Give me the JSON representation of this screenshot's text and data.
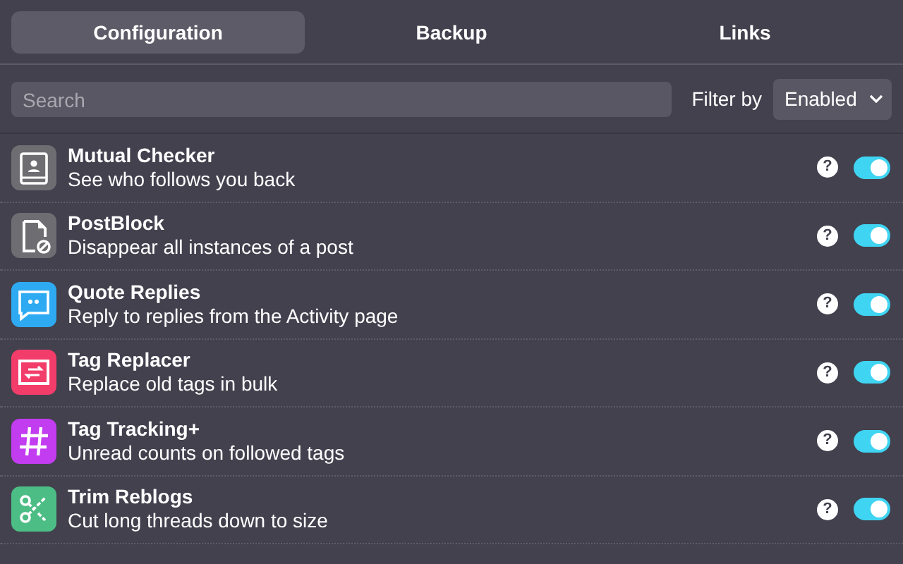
{
  "tabs": [
    {
      "label": "Configuration",
      "selected": true
    },
    {
      "label": "Backup",
      "selected": false
    },
    {
      "label": "Links",
      "selected": false
    }
  ],
  "search": {
    "placeholder": "Search"
  },
  "filter": {
    "label": "Filter by",
    "value": "Enabled"
  },
  "features": [
    {
      "title": "Mutual Checker",
      "description": "See who follows you back",
      "color": "#6e6e72",
      "help": "?",
      "on": true
    },
    {
      "title": "PostBlock",
      "description": "Disappear all instances of a post",
      "color": "#6e6e72",
      "help": "?",
      "on": true
    },
    {
      "title": "Quote Replies",
      "description": "Reply to replies from the Activity page",
      "color": "#2eaaf2",
      "help": "?",
      "on": true
    },
    {
      "title": "Tag Replacer",
      "description": "Replace old tags in bulk",
      "color": "#f23d6a",
      "help": "?",
      "on": true
    },
    {
      "title": "Tag Tracking+",
      "description": "Unread counts on followed tags",
      "color": "#c23cf0",
      "help": "?",
      "on": true
    },
    {
      "title": "Trim Reblogs",
      "description": "Cut long threads down to size",
      "color": "#4dbd86",
      "help": "?",
      "on": true
    }
  ]
}
